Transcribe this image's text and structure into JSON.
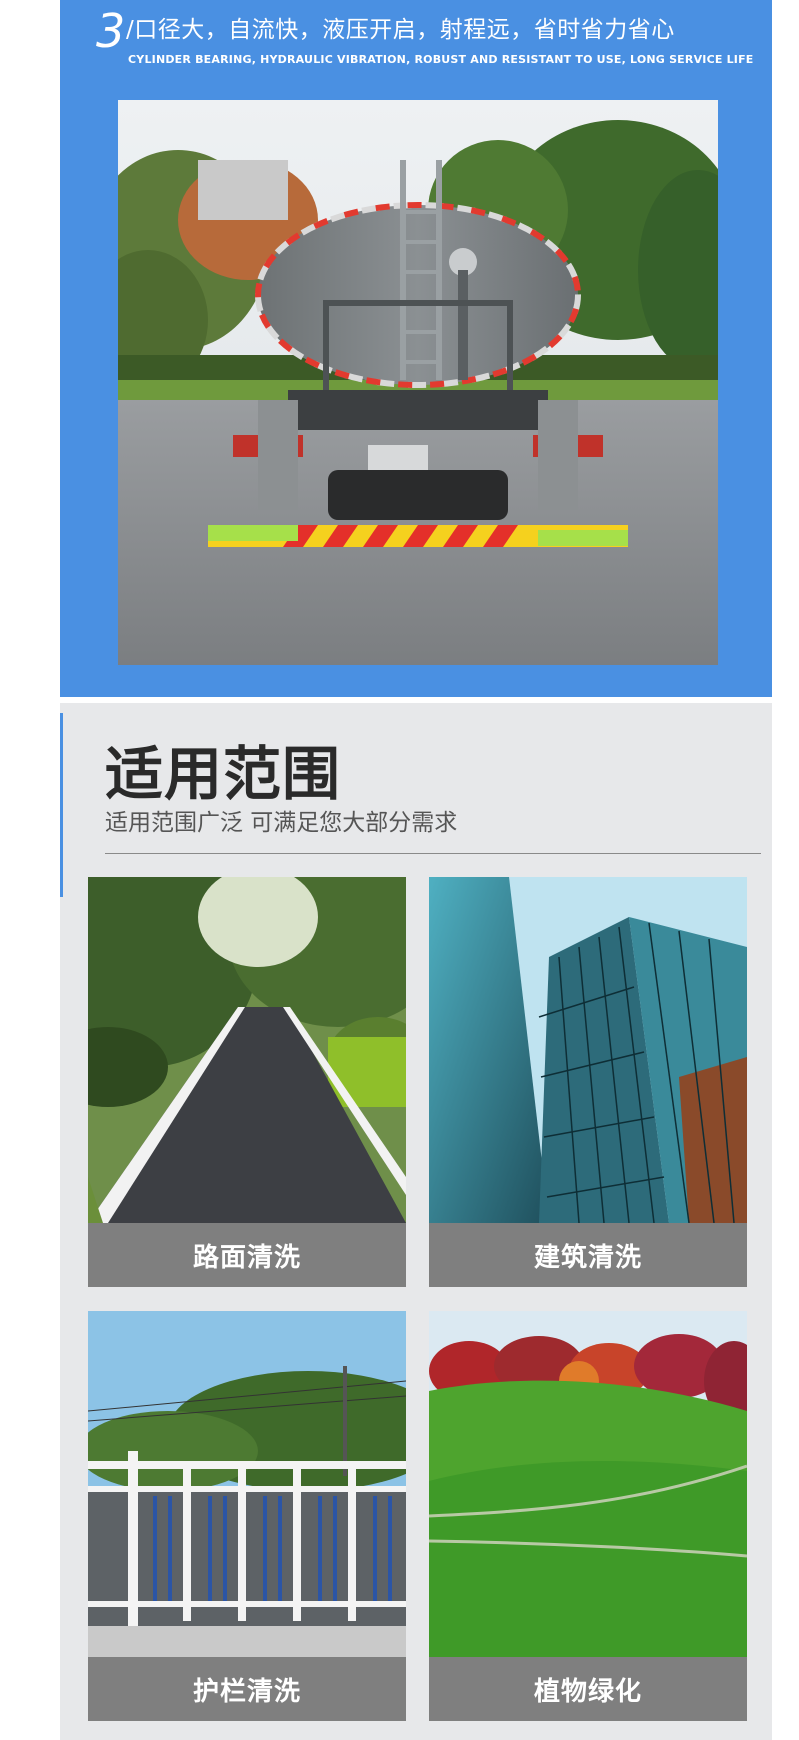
{
  "banner": {
    "number": "3",
    "headline": "/口径大，自流快，液压开启，射程远，省时省力省心",
    "subline": "CYLINDER BEARING, HYDRAULIC VIBRATION, ROBUST AND RESISTANT TO USE, LONG SERVICE LIFE"
  },
  "scope": {
    "title": "适用范围",
    "subtitle": "适用范围广泛 可满足您大部分需求",
    "cards": [
      {
        "label": "路面清洗",
        "image": "road-photo"
      },
      {
        "label": "建筑清洗",
        "image": "glass-building-photo"
      },
      {
        "label": "护栏清洗",
        "image": "guardrail-photo"
      },
      {
        "label": "植物绿化",
        "image": "grass-hill-photo"
      }
    ]
  },
  "colors": {
    "banner_blue": "#4a90e2",
    "panel_grey": "#e7e8ea",
    "label_grey": "#7f7f7f",
    "title_text": "#2a2a2a"
  }
}
